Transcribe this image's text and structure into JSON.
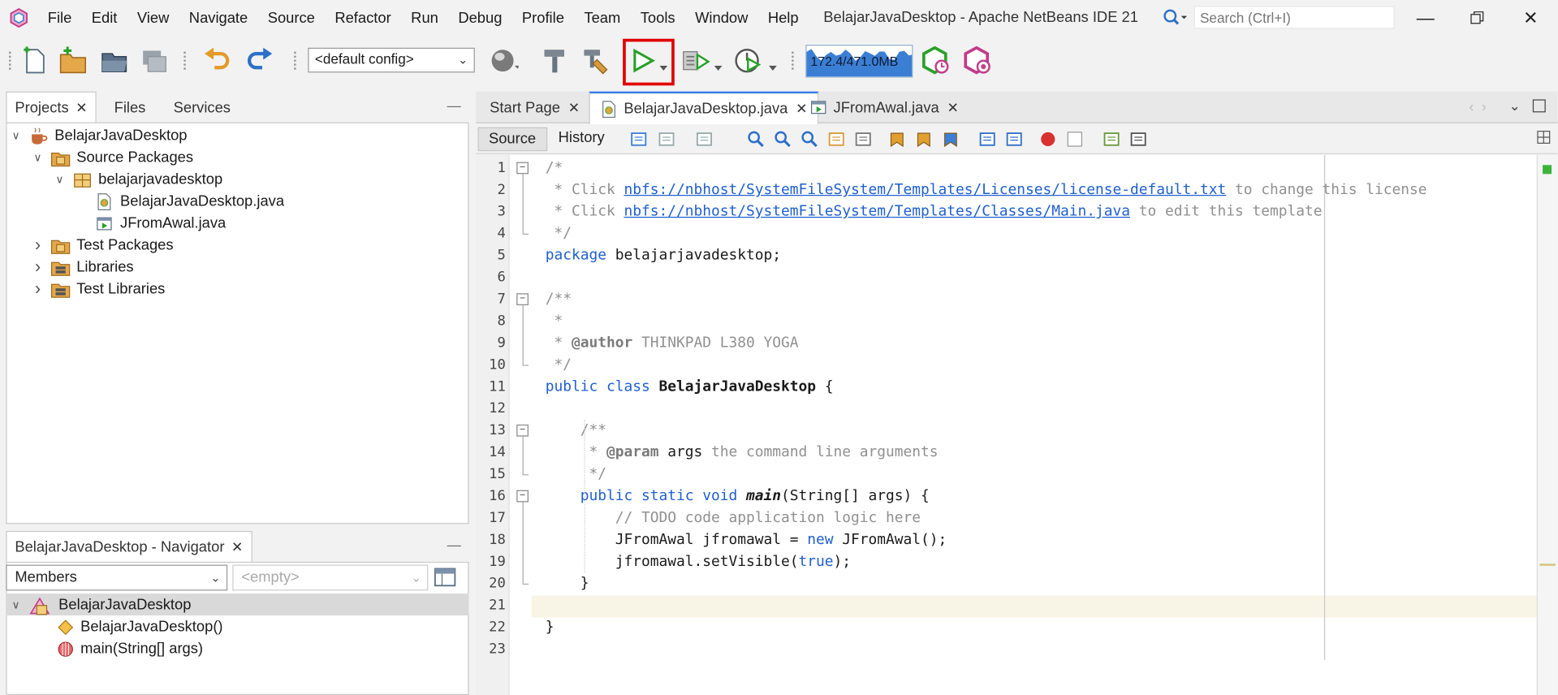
{
  "window": {
    "title": "BelajarJavaDesktop - Apache NetBeans IDE 21"
  },
  "menu": [
    "File",
    "Edit",
    "View",
    "Navigate",
    "Source",
    "Refactor",
    "Run",
    "Debug",
    "Profile",
    "Team",
    "Tools",
    "Window",
    "Help"
  ],
  "search": {
    "placeholder": "Search (Ctrl+I)"
  },
  "toolbar": {
    "config": "<default config>",
    "memory": "172.4/471.0MB",
    "memory_used_mb": 172.4,
    "memory_total_mb": 471.0
  },
  "projects_panel": {
    "tabs": [
      {
        "label": "Projects",
        "closable": true
      },
      {
        "label": "Files"
      },
      {
        "label": "Services"
      }
    ],
    "tree": [
      {
        "label": "BelajarJavaDesktop",
        "depth": 0,
        "expanded": true,
        "icon": "coffee-cup-project-icon"
      },
      {
        "label": "Source Packages",
        "depth": 1,
        "expanded": true,
        "icon": "package-folder-icon"
      },
      {
        "label": "belajarjavadesktop",
        "depth": 2,
        "expanded": true,
        "icon": "package-icon"
      },
      {
        "label": "BelajarJavaDesktop.java",
        "depth": 3,
        "icon": "java-file-icon"
      },
      {
        "label": "JFromAwal.java",
        "depth": 3,
        "icon": "java-form-file-icon"
      },
      {
        "label": "Test Packages",
        "depth": 1,
        "expanded": false,
        "icon": "package-folder-icon"
      },
      {
        "label": "Libraries",
        "depth": 1,
        "expanded": false,
        "icon": "libraries-icon"
      },
      {
        "label": "Test Libraries",
        "depth": 1,
        "expanded": false,
        "icon": "libraries-icon"
      }
    ]
  },
  "navigator": {
    "title": "BelajarJavaDesktop - Navigator",
    "filter": "Members",
    "filter2": "<empty>",
    "items": [
      {
        "label": "BelajarJavaDesktop",
        "depth": 0,
        "icon": "class-icon"
      },
      {
        "label": "BelajarJavaDesktop()",
        "depth": 1,
        "icon": "constructor-icon"
      },
      {
        "label": "main(String[] args)",
        "depth": 1,
        "icon": "method-icon"
      }
    ]
  },
  "editor": {
    "tabs": [
      {
        "label": "Start Page"
      },
      {
        "label": "BelajarJavaDesktop.java",
        "active": true
      },
      {
        "label": "JFromAwal.java"
      }
    ],
    "source_label": "Source",
    "history_label": "History",
    "lines": [
      "/*",
      " * Click nbfs://nbhost/SystemFileSystem/Templates/Licenses/license-default.txt to change this license",
      " * Click nbfs://nbhost/SystemFileSystem/Templates/Classes/Main.java to edit this template",
      " */",
      "package belajarjavadesktop;",
      "",
      "/**",
      " *",
      " * @author THINKPAD L380 YOGA",
      " */",
      "public class BelajarJavaDesktop {",
      "",
      "    /**",
      "     * @param args the command line arguments",
      "     */",
      "    public static void main(String[] args) {",
      "        // TODO code application logic here",
      "        JFromAwal jfromawal = new JFromAwal();",
      "        jfromawal.setVisible(true);",
      "    }",
      "",
      "}",
      ""
    ]
  }
}
